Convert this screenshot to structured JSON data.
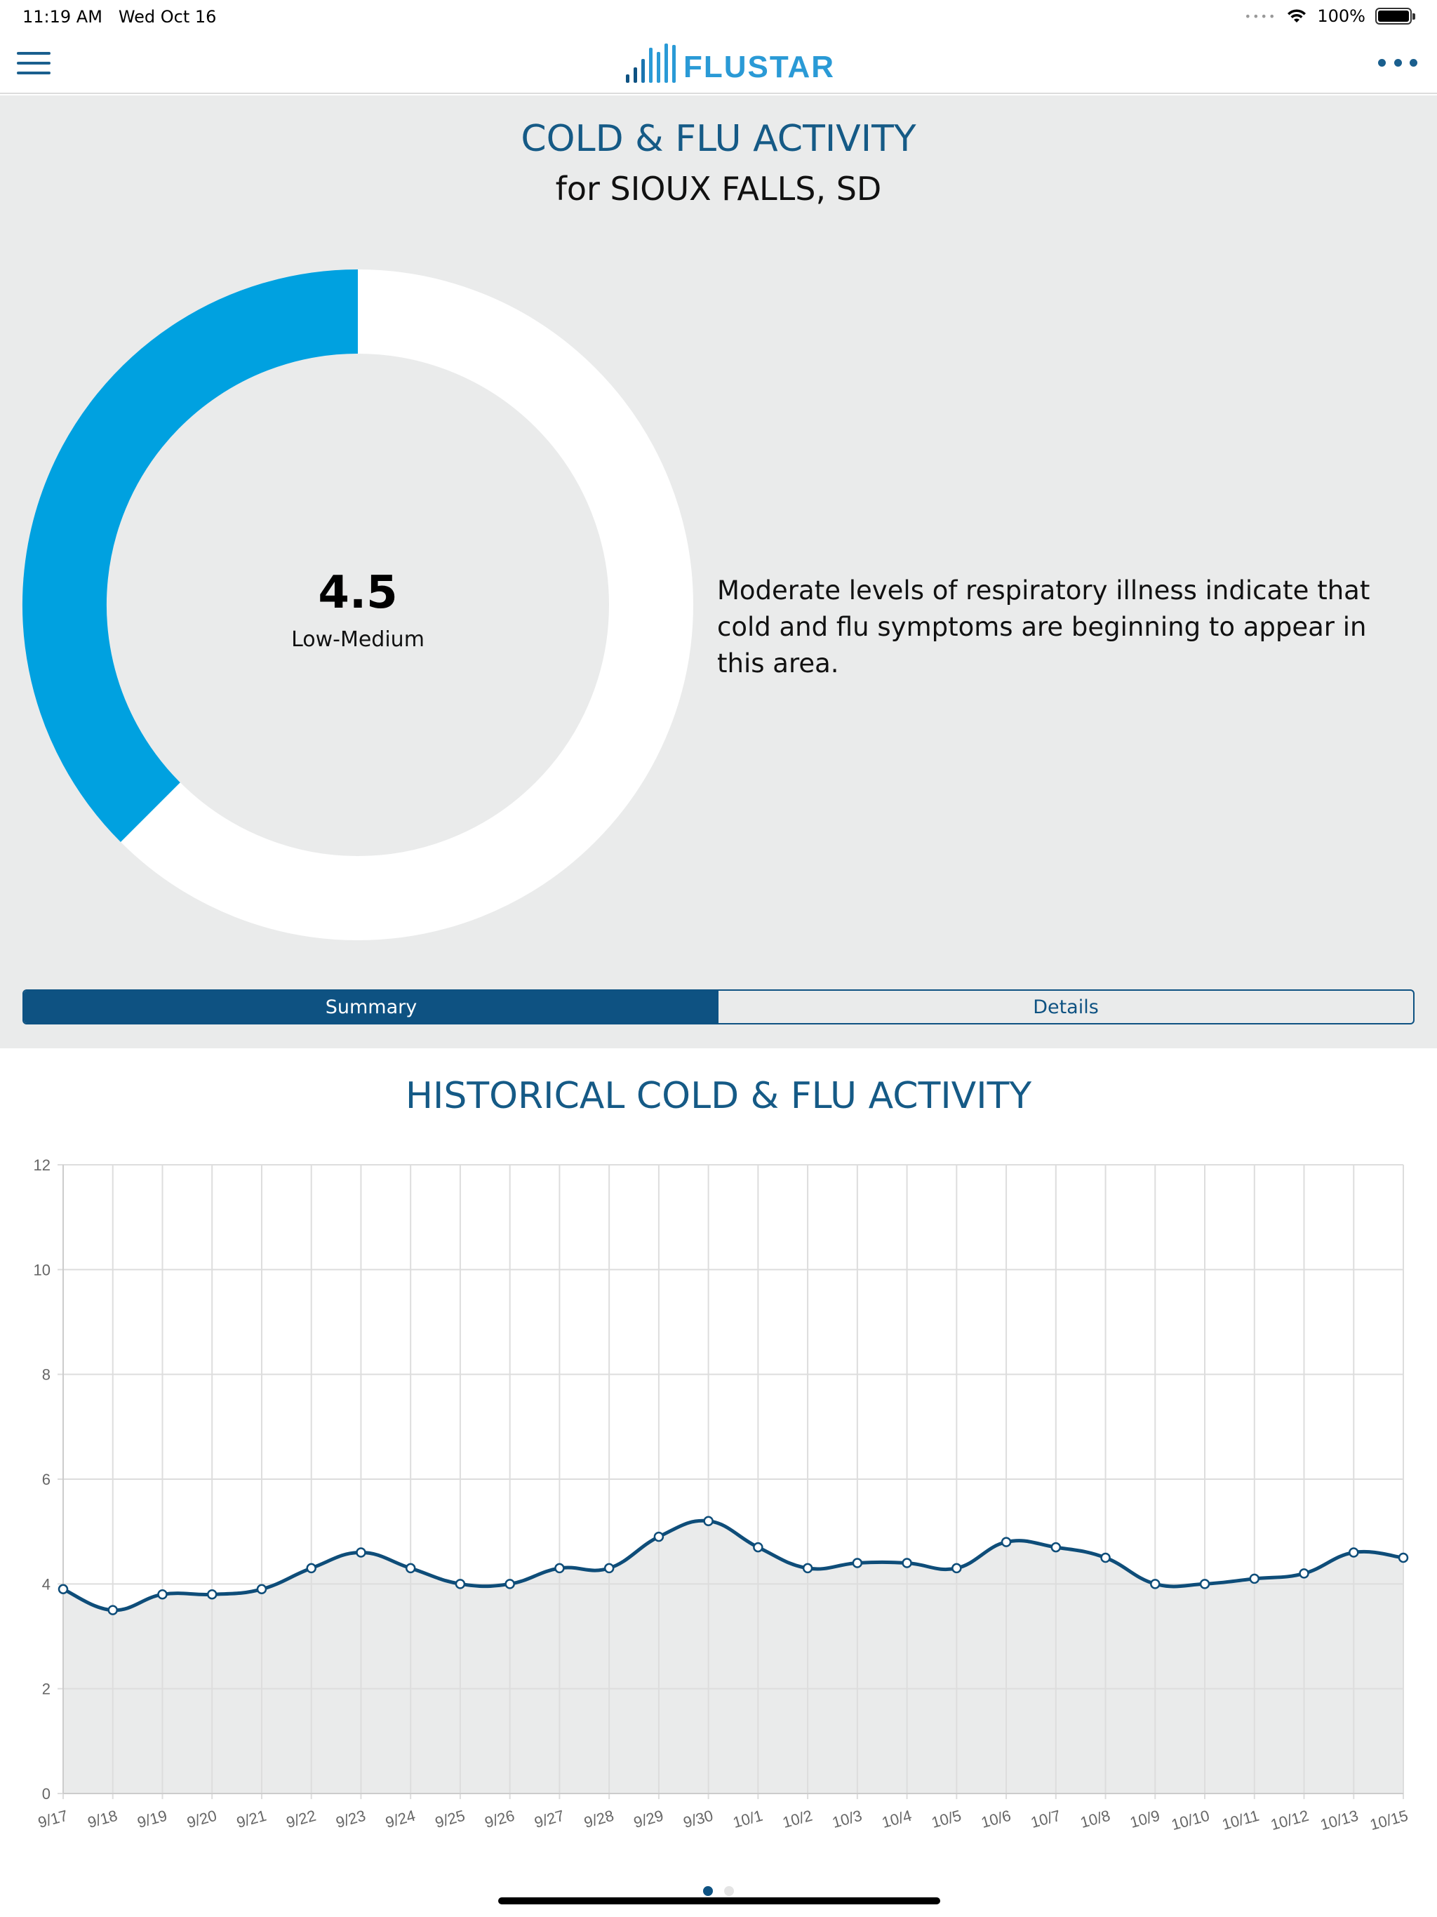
{
  "status_bar": {
    "time": "11:19 AM",
    "date": "Wed Oct 16",
    "battery": "100%"
  },
  "nav": {
    "logo_text": "FLUSTAR",
    "menu_icon": "hamburger-icon",
    "more_icon": "ellipsis-icon"
  },
  "summary": {
    "title": "COLD & FLU ACTIVITY",
    "location": "for SIOUX FALLS, SD",
    "score": "4.5",
    "level": "Low-Medium",
    "gauge_fraction": 0.375,
    "description": "Moderate levels of respiratory illness indicate that cold and flu symptoms are beginning to appear in this area."
  },
  "tabs": [
    {
      "label": "Summary",
      "active": true
    },
    {
      "label": "Details",
      "active": false
    }
  ],
  "history": {
    "title": "HISTORICAL COLD & FLU ACTIVITY"
  },
  "colors": {
    "accent": "#0e5282",
    "gauge_fill": "#00a1e0",
    "gauge_track": "#ffffff",
    "panel_bg": "#eaebeb"
  },
  "chart_data": {
    "type": "area",
    "categories": [
      "9/17",
      "9/18",
      "9/19",
      "9/20",
      "9/21",
      "9/22",
      "9/23",
      "9/24",
      "9/25",
      "9/26",
      "9/27",
      "9/28",
      "9/29",
      "9/30",
      "10/1",
      "10/2",
      "10/3",
      "10/4",
      "10/5",
      "10/6",
      "10/7",
      "10/8",
      "10/9",
      "10/10",
      "10/11",
      "10/12",
      "10/13",
      "10/15"
    ],
    "values": [
      3.9,
      3.5,
      3.8,
      3.8,
      3.9,
      4.3,
      4.6,
      4.3,
      4.0,
      4.0,
      4.3,
      4.3,
      4.9,
      5.2,
      4.7,
      4.3,
      4.4,
      4.4,
      4.3,
      4.8,
      4.7,
      4.5,
      4.0,
      4.0,
      4.1,
      4.2,
      4.6,
      4.5
    ],
    "yticks": [
      "0",
      "2",
      "4",
      "6",
      "8",
      "10",
      "12"
    ],
    "ylim": [
      0,
      12
    ],
    "grid": true,
    "line_color": "#0e4d79",
    "fill_color": "#eaebeb"
  },
  "pager": {
    "pages": 2,
    "current": 1
  }
}
